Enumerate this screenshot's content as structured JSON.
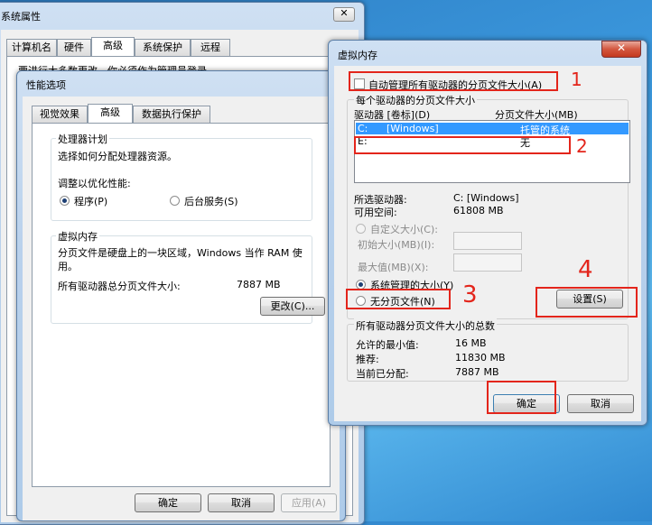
{
  "system_properties": {
    "title": "系统属性",
    "tabs": [
      "计算机名",
      "硬件",
      "高级",
      "系统保护",
      "远程"
    ],
    "partial_text": "要进行大多数更改，你必须作为管理员登录",
    "close_glyph": "✕"
  },
  "performance_options": {
    "title": "性能选项",
    "tabs": [
      "视觉效果",
      "高级",
      "数据执行保护"
    ],
    "processor_group_label": "处理器计划",
    "processor_desc": "选择如何分配处理器资源。",
    "adjust_label": "调整以优化性能:",
    "radio_programs": "程序(P)",
    "radio_background": "后台服务(S)",
    "vm_group_label": "虚拟内存",
    "vm_desc_line1": "分页文件是硬盘上的一块区域，Windows 当作 RAM 使",
    "vm_desc_line2": "用。",
    "vm_total_label": "所有驱动器总分页文件大小:",
    "vm_total_value": "7887 MB",
    "change_button": "更改(C)...",
    "ok_button": "确定",
    "cancel_button": "取消",
    "apply_button": "应用(A)"
  },
  "virtual_memory": {
    "title": "虚拟内存",
    "close_glyph": "✕",
    "auto_manage_label": "自动管理所有驱动器的分页文件大小(A)",
    "per_drive_label": "每个驱动器的分页文件大小",
    "col_drive": "驱动器 [卷标](D)",
    "col_size": "分页文件大小(MB)",
    "drives": [
      {
        "drive": "C:",
        "label": "[Windows]",
        "size": "托管的系统"
      },
      {
        "drive": "E:",
        "label": "",
        "size": "无"
      }
    ],
    "selected_drive_label": "所选驱动器:",
    "selected_drive_value": "C:  [Windows]",
    "free_space_label": "可用空间:",
    "free_space_value": "61808 MB",
    "custom_size": "自定义大小(C):",
    "initial_size": "初始大小(MB)(I):",
    "max_size": "最大值(MB)(X):",
    "system_managed": "系统管理的大小(Y)",
    "no_paging_file": "无分页文件(N)",
    "set_button": "设置(S)",
    "total_group_label": "所有驱动器分页文件大小的总数",
    "min_allowed_label": "允许的最小值:",
    "min_allowed_value": "16 MB",
    "recommended_label": "推荐:",
    "recommended_value": "11830 MB",
    "allocated_label": "当前已分配:",
    "allocated_value": "7887 MB",
    "ok_button": "确定",
    "cancel_button": "取消"
  },
  "annotations": [
    "1",
    "2",
    "3",
    "4"
  ],
  "colors": {
    "annotation_red": "#e3251b",
    "selection_blue": "#3399ff",
    "desktop_blue": "#3d9be0"
  }
}
